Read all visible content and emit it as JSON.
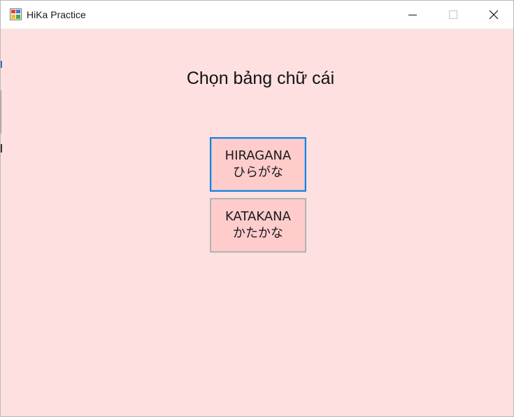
{
  "window": {
    "title": "HiKa Practice",
    "icon": "app-icon",
    "controls": [
      "minimize-icon",
      "maximize-icon",
      "close-icon"
    ]
  },
  "main": {
    "heading": "Chọn bảng chữ cái",
    "buttons": [
      {
        "label": "HIRAGANA",
        "sublabel": "ひらがな",
        "focused": true
      },
      {
        "label": "KATAKANA",
        "sublabel": "かたかな",
        "focused": false
      }
    ]
  },
  "colors": {
    "background": "#ffe0e0",
    "button_fill": "#ffcccc",
    "focus_border": "#1e7fd6",
    "button_border": "#b3b3b3"
  }
}
